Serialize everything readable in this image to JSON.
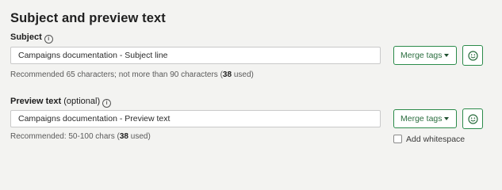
{
  "section_title": "Subject and preview text",
  "subject": {
    "label": "Subject",
    "value": "Campaigns documentation - Subject line",
    "hint_prefix": "Recommended 65 characters; not more than 90 characters (",
    "hint_count": "38",
    "hint_suffix": " used)",
    "merge_tags_label": "Merge tags"
  },
  "preview": {
    "label": "Preview text",
    "label_suffix": " (optional)",
    "value": "Campaigns documentation - Preview text",
    "hint_prefix": "Recommended: 50-100 chars (",
    "hint_count": "38",
    "hint_suffix": " used)",
    "merge_tags_label": "Merge tags",
    "whitespace_label": "Add whitespace"
  },
  "info_glyph": "i",
  "colors": {
    "accent": "#2b8b4a",
    "background": "#f3f3f1"
  }
}
